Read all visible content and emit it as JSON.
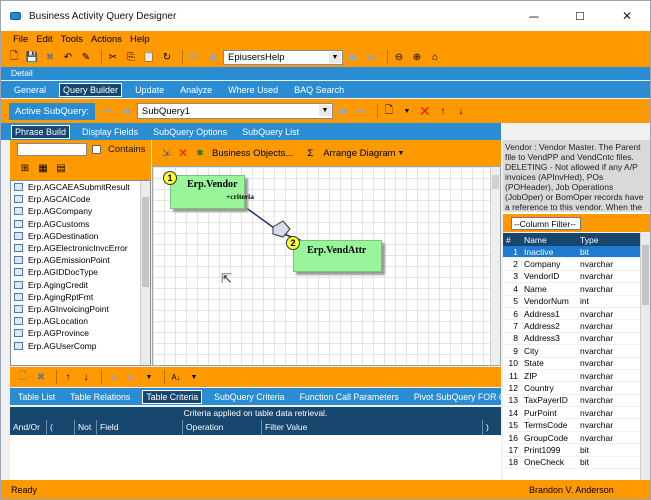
{
  "window": {
    "title": "Business Activity Query Designer",
    "minimize": "─",
    "maximize": "☐",
    "close": "✕"
  },
  "menu": [
    "File",
    "Edit",
    "Tools",
    "Actions",
    "Help"
  ],
  "toolbar": {
    "company_combo": "EpiusersHelp"
  },
  "detail_label": "Detail",
  "main_tabs": [
    {
      "label": "General"
    },
    {
      "label": "Query Builder",
      "active": true
    },
    {
      "label": "Update"
    },
    {
      "label": "Analyze"
    },
    {
      "label": "Where Used"
    },
    {
      "label": "BAQ Search"
    }
  ],
  "subquery": {
    "label": "Active SubQuery:",
    "value": "SubQuery1"
  },
  "sub_tabs": [
    {
      "label": "Phrase Build",
      "active": true
    },
    {
      "label": "Display Fields"
    },
    {
      "label": "SubQuery Options"
    },
    {
      "label": "SubQuery List"
    }
  ],
  "table_filter": {
    "contains_label": "Contains",
    "value": ""
  },
  "tables": [
    "Erp.AGCAEASubmitResult",
    "Erp.AGCAICode",
    "Erp.AGCompany",
    "Erp.AGCustoms",
    "Erp.AGDestination",
    "Erp.AGElectronicInvcError",
    "Erp.AGEmissionPoint",
    "Erp.AGIDDocType",
    "Erp.AgingCredit",
    "Erp.AgingRptFmt",
    "Erp.AGInvoicingPoint",
    "Erp.AGLocation",
    "Erp.AGProvince",
    "Erp.AGUserComp"
  ],
  "diagram_toolbar": {
    "business_objects": "Business Objects...",
    "sigma": "Σ",
    "arrange": "Arrange Diagram"
  },
  "nodes": [
    {
      "badge": "1",
      "name": "Erp.Vendor",
      "note": "+criteria"
    },
    {
      "badge": "2",
      "name": "Erp.VendAttr",
      "note": ""
    }
  ],
  "criteria_tabs": [
    {
      "label": "Table List"
    },
    {
      "label": "Table Relations"
    },
    {
      "label": "Table Criteria",
      "active": true
    },
    {
      "label": "SubQuery Criteria"
    },
    {
      "label": "Function Call Parameters"
    },
    {
      "label": "Pivot SubQuery FOR Clause"
    }
  ],
  "criteria_info": "Criteria applied on  table data retrieval.",
  "criteria_columns": [
    "And/Or",
    "(",
    "Not",
    "Field",
    "Operation",
    "Filter Value",
    ")"
  ],
  "description": "Vendor : Vendor Master. The Parent file to VendPP and VendCntc files. DELETING - Not allowed if any A/P invoices (APInvHed), POs (POHeader), Job Operations (JobOper) or BomOper records have a reference to this vendor. When the Vendor is deleted all of the",
  "column_filter": "--Column Filter--",
  "column_headers": {
    "num": "#",
    "name": "Name",
    "type": "Type"
  },
  "columns": [
    {
      "num": "1",
      "name": "Inactive",
      "type": "bit"
    },
    {
      "num": "2",
      "name": "Company",
      "type": "nvarchar"
    },
    {
      "num": "3",
      "name": "VendorID",
      "type": "nvarchar"
    },
    {
      "num": "4",
      "name": "Name",
      "type": "nvarchar"
    },
    {
      "num": "5",
      "name": "VendorNum",
      "type": "int"
    },
    {
      "num": "6",
      "name": "Address1",
      "type": "nvarchar"
    },
    {
      "num": "7",
      "name": "Address2",
      "type": "nvarchar"
    },
    {
      "num": "8",
      "name": "Address3",
      "type": "nvarchar"
    },
    {
      "num": "9",
      "name": "City",
      "type": "nvarchar"
    },
    {
      "num": "10",
      "name": "State",
      "type": "nvarchar"
    },
    {
      "num": "11",
      "name": "ZIP",
      "type": "nvarchar"
    },
    {
      "num": "12",
      "name": "Country",
      "type": "nvarchar"
    },
    {
      "num": "13",
      "name": "TaxPayerID",
      "type": "nvarchar"
    },
    {
      "num": "14",
      "name": "PurPoint",
      "type": "nvarchar"
    },
    {
      "num": "15",
      "name": "TermsCode",
      "type": "nvarchar"
    },
    {
      "num": "16",
      "name": "GroupCode",
      "type": "nvarchar"
    },
    {
      "num": "17",
      "name": "Print1099",
      "type": "bit"
    },
    {
      "num": "18",
      "name": "OneCheck",
      "type": "bit"
    }
  ],
  "status": {
    "left": "Ready",
    "user": "Brandon V. Anderson"
  },
  "colors": {
    "accent": "#ff9900",
    "tab_blue": "#2a8dd4",
    "dark_blue": "#17466e",
    "node_green": "#99f599"
  }
}
